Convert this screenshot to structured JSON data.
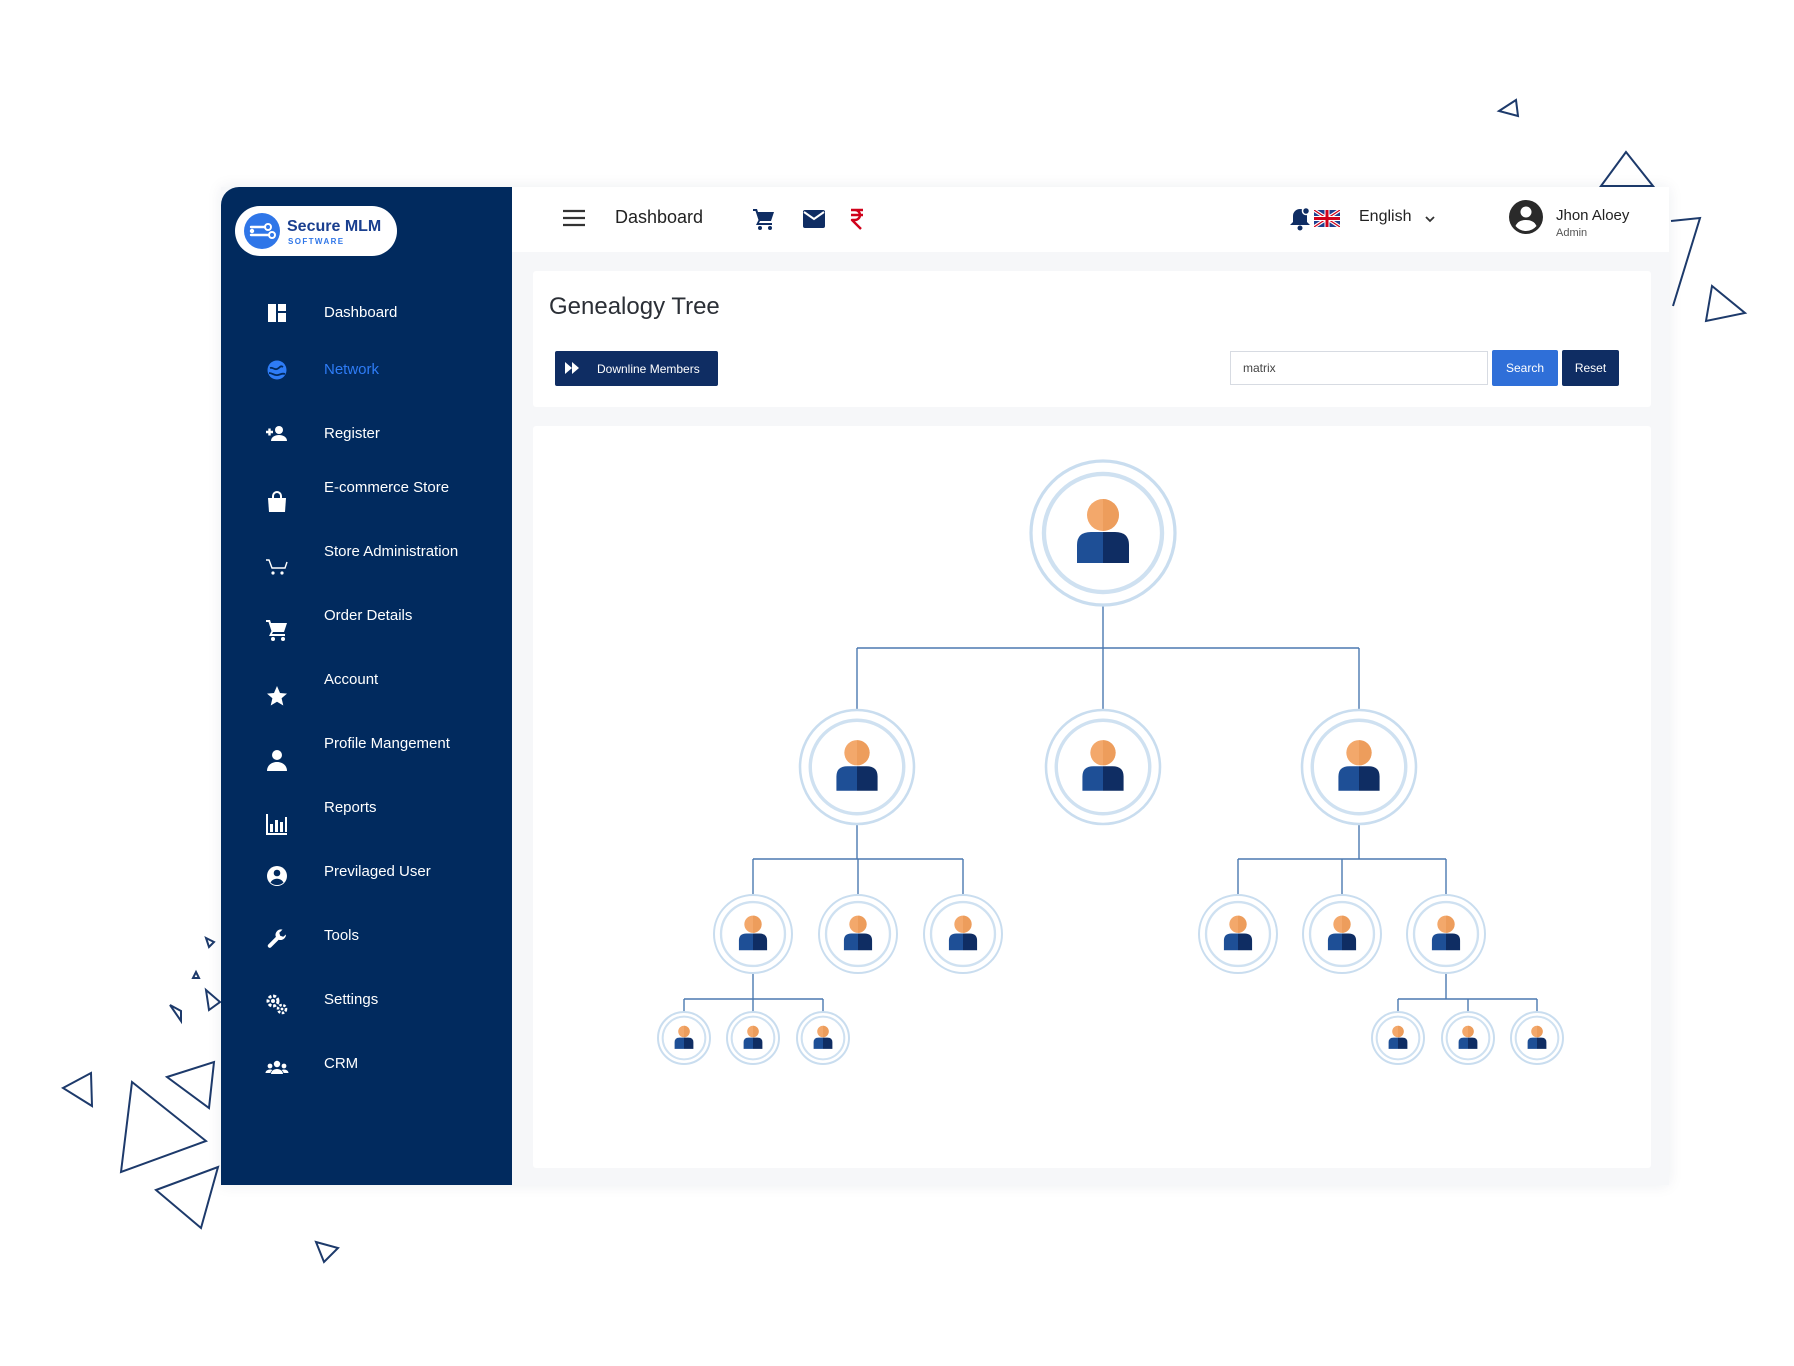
{
  "brand": {
    "name": "Secure MLM",
    "tagline": "SOFTWARE"
  },
  "sidebar": {
    "items": [
      {
        "label": "Dashboard",
        "icon": "dashboard-icon",
        "active": false
      },
      {
        "label": "Network",
        "icon": "network-globe-icon",
        "active": true
      },
      {
        "label": "Register",
        "icon": "add-user-icon",
        "active": false
      },
      {
        "label": "E-commerce Store",
        "icon": "shopping-bag-icon",
        "active": false
      },
      {
        "label": "Store Administration",
        "icon": "cart-outline-icon",
        "active": false
      },
      {
        "label": "Order Details",
        "icon": "shopping-cart-icon",
        "active": false
      },
      {
        "label": "Account",
        "icon": "star-icon",
        "active": false
      },
      {
        "label": "Profile Mangement",
        "icon": "user-icon",
        "active": false
      },
      {
        "label": "Reports",
        "icon": "bar-chart-icon",
        "active": false
      },
      {
        "label": "Previlaged User",
        "icon": "account-circle-icon",
        "active": false
      },
      {
        "label": "Tools",
        "icon": "wrench-icon",
        "active": false
      },
      {
        "label": "Settings",
        "icon": "gears-icon",
        "active": false
      },
      {
        "label": "CRM",
        "icon": "group-icon",
        "active": false
      }
    ]
  },
  "topbar": {
    "title": "Dashboard",
    "icons": [
      "menu-icon",
      "cart-icon",
      "mail-icon",
      "rupee-icon",
      "notification-bell-icon",
      "uk-flag-icon"
    ],
    "language": "English",
    "user": {
      "name": "Jhon Aloey",
      "role": "Admin"
    }
  },
  "page": {
    "title": "Genealogy Tree",
    "downline_button": "Downline Members",
    "search": {
      "value": "matrix",
      "placeholder": ""
    },
    "search_button": "Search",
    "reset_button": "Reset"
  },
  "tree": {
    "root": {
      "children": [
        {
          "children": [
            {
              "children": [
                {},
                {},
                {}
              ]
            },
            {
              "children": []
            },
            {
              "children": []
            }
          ]
        },
        {
          "children": []
        },
        {
          "children": [
            {
              "children": []
            },
            {
              "children": []
            },
            {
              "children": [
                {},
                {},
                {}
              ]
            }
          ]
        }
      ]
    }
  },
  "colors": {
    "sidebar_bg": "#012a5e",
    "active_nav": "#2e7cf6",
    "primary_button": "#2f6fd8",
    "dark_button": "#0f2d63",
    "rupee": "#d0021b",
    "avatar_head": "#f3a86b",
    "avatar_body": "#1e4f96"
  }
}
